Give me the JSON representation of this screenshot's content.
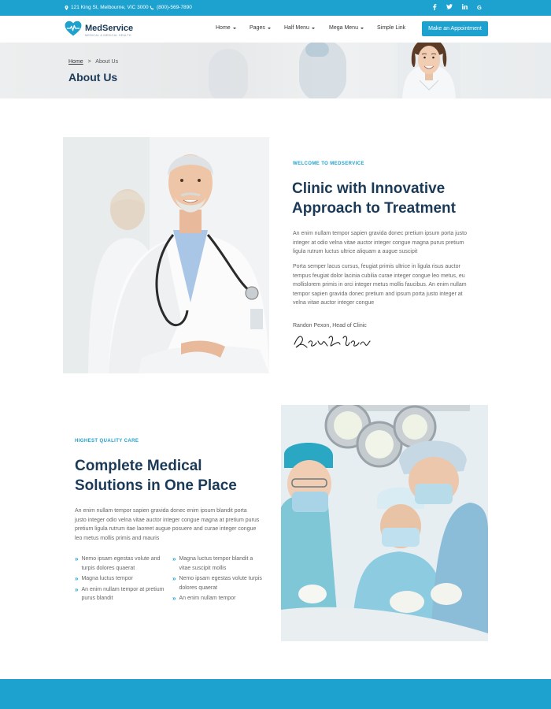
{
  "topbar": {
    "address": "121 King St, Melbourne, VIC 3000",
    "phone": "(800)-569-7890",
    "socials": [
      "facebook-icon",
      "twitter-icon",
      "linkedin-icon",
      "google-icon"
    ]
  },
  "brand": {
    "name": "MedService",
    "tagline": "MEDICAL & MEDICAL HEALTH"
  },
  "nav": {
    "items": [
      {
        "label": "Home"
      },
      {
        "label": "Pages"
      },
      {
        "label": "Half Menu"
      },
      {
        "label": "Mega Menu"
      },
      {
        "label": "Simple Link"
      }
    ],
    "cta": "Make an Appointment"
  },
  "title_band": {
    "breadcrumb_home": "Home",
    "breadcrumb_sep": ">",
    "breadcrumb_current": "About Us",
    "title": "About Us"
  },
  "about": {
    "eyebrow": "WELCOME TO MEDSERVICE",
    "heading_line1": "Clinic with Innovative",
    "heading_line2": "Approach to Treatment",
    "para1": "An enim nullam tempor sapien gravida donec pretium ipsum porta justo integer at odio velna vitae auctor integer congue magna purus pretium ligula rutrum luctus ultrice aliquam a augue suscipit",
    "para2": "Porta semper lacus cursus, feugiat primis ultrice in ligula risus auctor tempus feugiat dolor lacinia cubilia curae integer congue leo metus, eu mollislorem primis in orci integer metus mollis faucibus. An enim nullam tempor sapien gravida donec pretium and ipsum porta justo integer at velna vitae auctor integer congue",
    "signer": "Randon Pexon, Head of Clinic"
  },
  "quality": {
    "eyebrow": "HIGHEST QUALITY CARE",
    "heading_line1": "Complete Medical",
    "heading_line2": "Solutions in One Place",
    "para": "An enim nullam tempor sapien gravida donec enim ipsum blandit porta justo integer odio velna vitae auctor integer congue magna at pretium purus pretium ligula rutrum itae laoreet augue posuere and curae integer congue leo metus mollis primis and mauris",
    "list_left": [
      "Nemo ipsam egestas volute and turpis dolores quaerat",
      "Magna luctus tempor",
      "An enim nullam tempor at pretium purus blandit"
    ],
    "list_right": [
      "Magna luctus tempor blandit a vitae suscipit mollis",
      "Nemo ipsam egestas volute turpis dolores quaerat",
      "An enim nullam tempor"
    ]
  },
  "colors": {
    "accent": "#1da1cf",
    "heading": "#1b3a57"
  }
}
